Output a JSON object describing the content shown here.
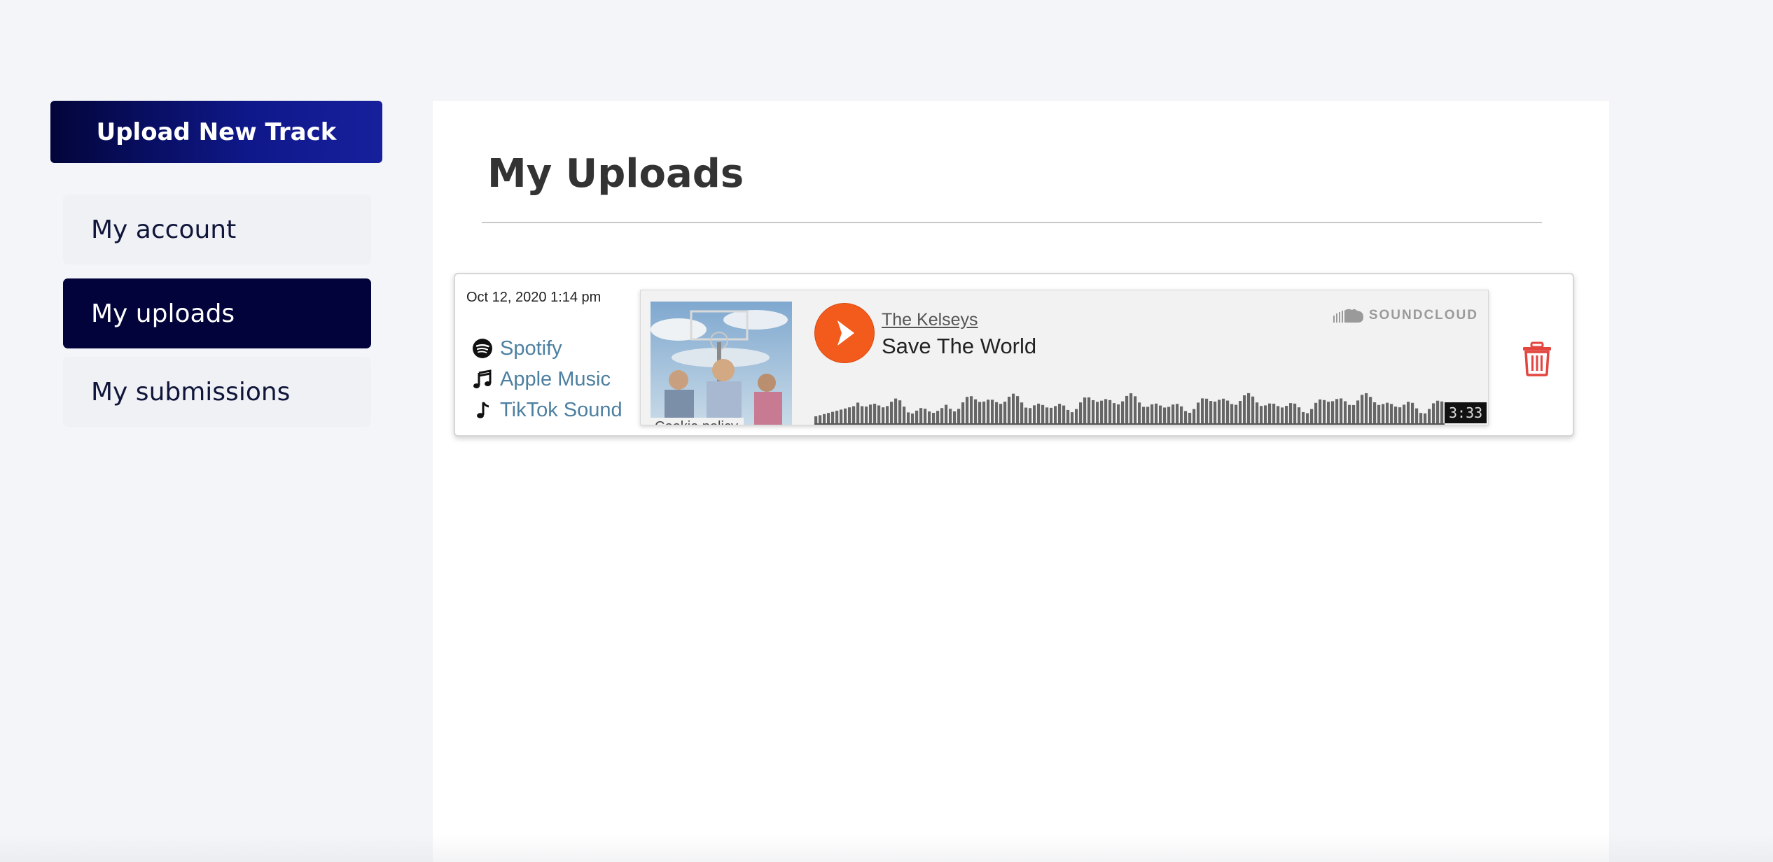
{
  "sidebar": {
    "upload_button_label": "Upload New Track",
    "items": [
      {
        "label": "My account",
        "active": false
      },
      {
        "label": "My uploads",
        "active": true
      },
      {
        "label": "My submissions",
        "active": false
      }
    ]
  },
  "main": {
    "title": "My Uploads",
    "uploads": [
      {
        "date": "Oct 12, 2020 1:14 pm",
        "links": [
          {
            "label": "Spotify",
            "icon": "spotify-icon"
          },
          {
            "label": "Apple Music",
            "icon": "music-note-icon"
          },
          {
            "label": "TikTok Sound",
            "icon": "tiktok-note-icon"
          }
        ],
        "player": {
          "artist": "The Kelseys",
          "track": "Save The World",
          "brand": "SOUNDCLOUD",
          "duration": "3:33",
          "cookie_label": "Cookie policy"
        }
      }
    ]
  },
  "colors": {
    "accent_dark": "#02033a",
    "upload_gradient_end": "#17209c",
    "link": "#4d7fa0",
    "soundcloud_orange": "#f35b1c",
    "delete_red": "#e2463f"
  }
}
